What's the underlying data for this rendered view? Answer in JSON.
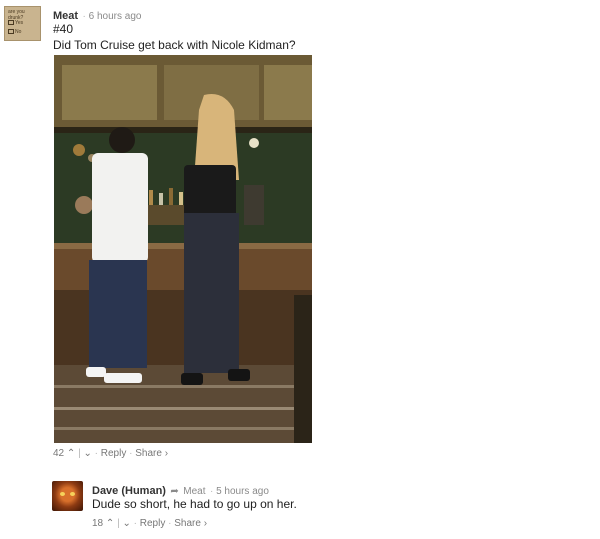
{
  "post": {
    "author": "Meat",
    "time": "6 hours ago",
    "number": "#40",
    "text": "Did Tom Cruise get back with Nicole Kidman?",
    "avatar_text": {
      "question": "are you drunk?",
      "opt1": "Yes",
      "opt2": "No"
    },
    "votes": "42",
    "reply_label": "Reply",
    "share_label": "Share ›"
  },
  "reply": {
    "author": "Dave (Human)",
    "replying_to": "Meat",
    "time": "5 hours ago",
    "text": "Dude so short, he had to go up on her.",
    "votes": "18",
    "reply_label": "Reply",
    "share_label": "Share ›"
  },
  "icons": {
    "upvote": "chevron-up-icon",
    "downvote": "chevron-down-icon",
    "reply_arrow": "reply-arrow-icon"
  }
}
